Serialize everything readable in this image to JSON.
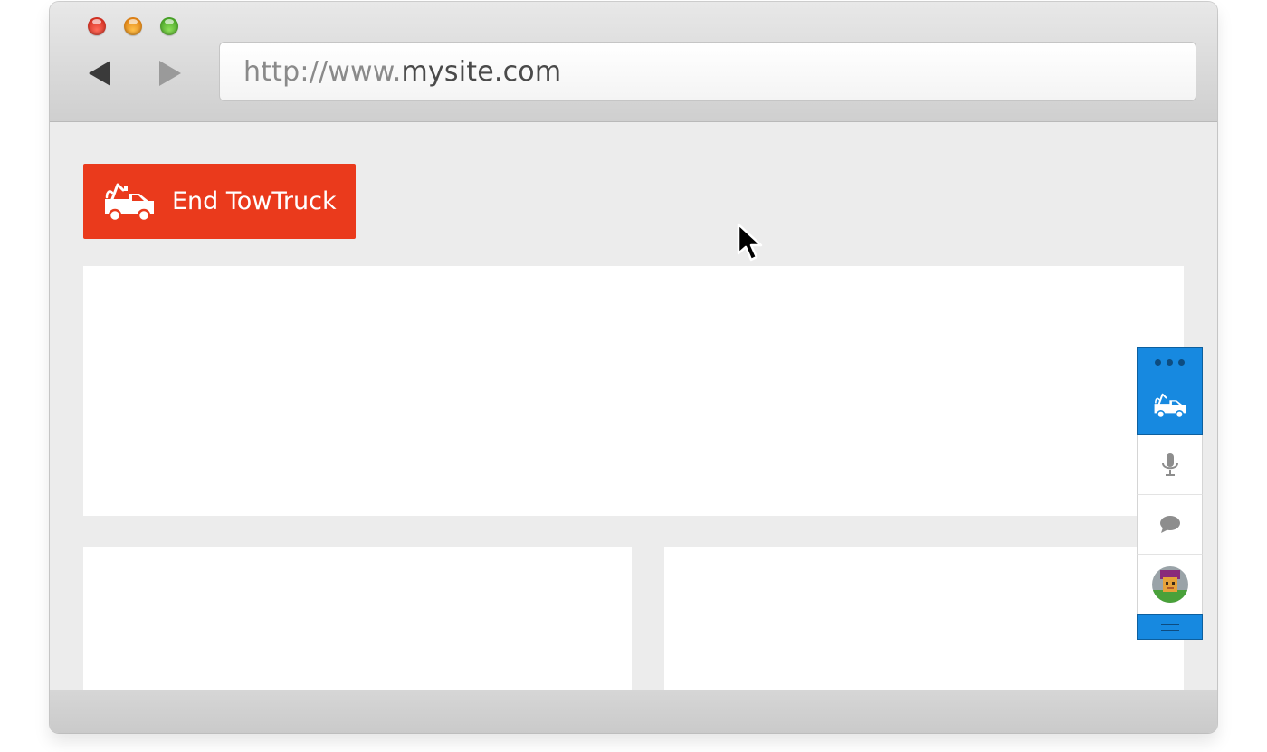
{
  "browser": {
    "url_protocol": "http://www.",
    "url_host": "mysite.com"
  },
  "page": {
    "end_button_label": "End TowTruck"
  },
  "dock": {
    "buttons": [
      {
        "icon": "towtruck-icon",
        "active": true
      },
      {
        "icon": "microphone-icon",
        "active": false
      },
      {
        "icon": "chat-bubble-icon",
        "active": false
      },
      {
        "icon": "user-avatar",
        "active": false
      }
    ]
  },
  "colors": {
    "accent_red": "#ea3a1c",
    "dock_blue": "#1789e0",
    "page_background": "#ececec"
  }
}
